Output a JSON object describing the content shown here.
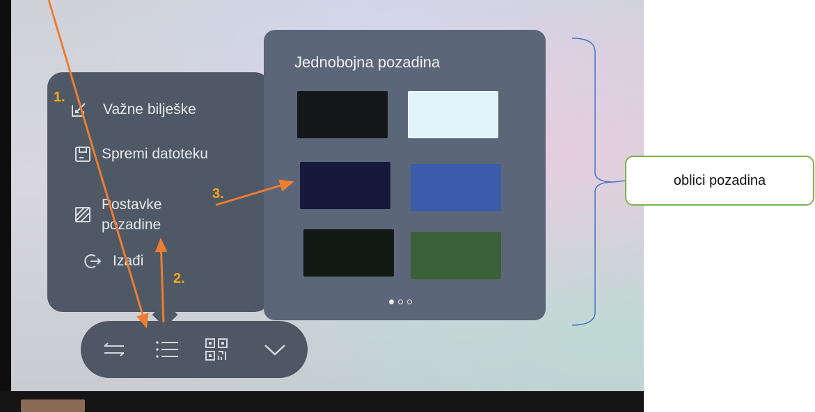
{
  "menu": {
    "items": [
      {
        "label": "Važne bilješke",
        "icon": "notes-edit-icon"
      },
      {
        "label": "Spremi datoteku",
        "icon": "save-file-icon"
      },
      {
        "label": "Postavke\npozadine",
        "icon": "background-settings-icon"
      },
      {
        "label": "Izađi",
        "icon": "exit-icon"
      }
    ]
  },
  "background_panel": {
    "title": "Jednobojna pozadina",
    "swatches": [
      {
        "color": "#161719"
      },
      {
        "color": "#dff3fb"
      },
      {
        "color": "#16193a"
      },
      {
        "color": "#3b5bab"
      },
      {
        "color": "#121a16"
      },
      {
        "color": "#3a6137"
      }
    ],
    "pages": 3,
    "current_page": 1
  },
  "toolbar": {
    "buttons": [
      {
        "icon": "swap-arrows-icon"
      },
      {
        "icon": "menu-list-icon"
      },
      {
        "icon": "qr-code-icon"
      },
      {
        "icon": "chevron-down-icon"
      }
    ]
  },
  "annotations": {
    "step1": "1.",
    "step2": "2.",
    "step3": "3.",
    "callout": "oblici pozadina",
    "arrow_color": "#ed7d31",
    "bracket_color": "#4472c4",
    "callout_border": "#7ab24d",
    "number_color": "#f2a81d"
  }
}
